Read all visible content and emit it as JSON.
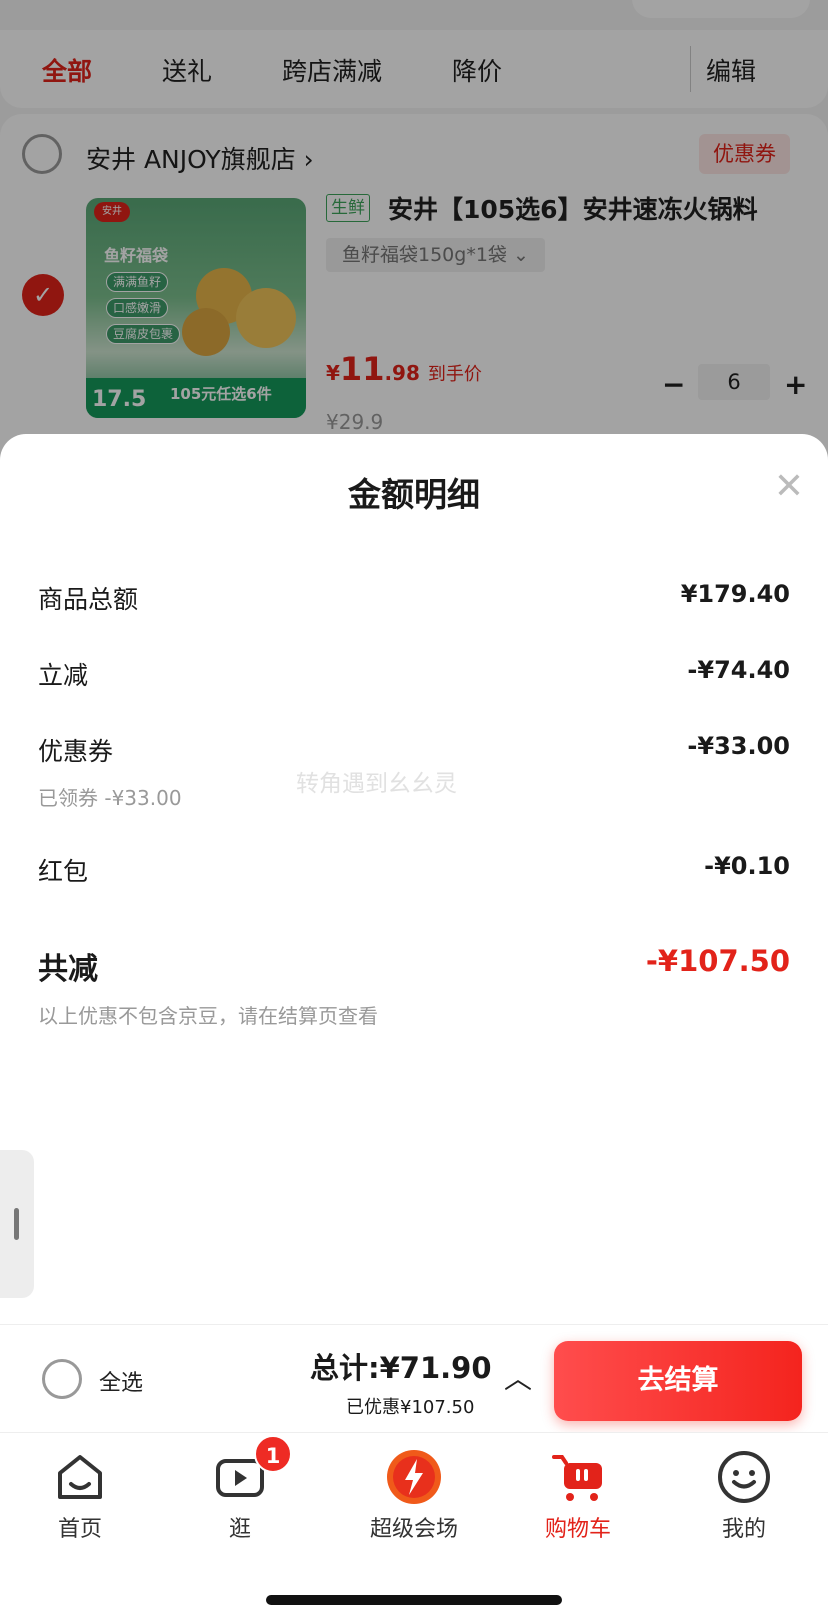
{
  "tabs": [
    "全部",
    "送礼",
    "跨店满减",
    "降价"
  ],
  "edit_label": "编辑",
  "shop": {
    "name": "安井 ANJOY旗舰店 ›",
    "coupon_label": "优惠券"
  },
  "product": {
    "fresh_tag": "生鲜",
    "title": "安井【105选6】安井速冻火锅料",
    "variant": "鱼籽福袋150g*1袋 ⌄",
    "price_yen": "¥",
    "price_int": "11",
    "price_dec": ".98",
    "price_note": "到手价",
    "original_price": "¥29.9",
    "quantity": "6",
    "image": {
      "logo": "安井",
      "title": "鱼籽福袋",
      "chips": [
        "满满鱼籽",
        "口感嫩滑",
        "豆腐皮包裹"
      ],
      "price": "17.5",
      "offer": "105元任选6件"
    }
  },
  "sheet": {
    "title": "金额明细",
    "rows": [
      {
        "label": "商品总额",
        "value": "¥179.40"
      },
      {
        "label": "立减",
        "value": "-¥74.40"
      },
      {
        "label": "优惠券",
        "value": "-¥33.00",
        "sub": "已领券 -¥33.00"
      },
      {
        "label": "红包",
        "value": "-¥0.10"
      }
    ],
    "total_label": "共减",
    "total_value": "-¥107.50",
    "note": "以上优惠不包含京豆，请在结算页查看",
    "watermark": "转角遇到幺幺灵"
  },
  "checkout": {
    "select_all": "全选",
    "total": "总计:¥71.90",
    "saved": "已优惠¥107.50",
    "button": "去结算"
  },
  "tabbar": {
    "items": [
      {
        "label": "首页",
        "icon": "home-icon"
      },
      {
        "label": "逛",
        "icon": "video-icon",
        "badge": "1"
      },
      {
        "label": "超级会场",
        "icon": "super-venue-icon"
      },
      {
        "label": "购物车",
        "icon": "cart-icon"
      },
      {
        "label": "我的",
        "icon": "smiley-icon"
      }
    ]
  },
  "colors": {
    "accent": "#e2231a",
    "fresh": "#3ea55b"
  }
}
